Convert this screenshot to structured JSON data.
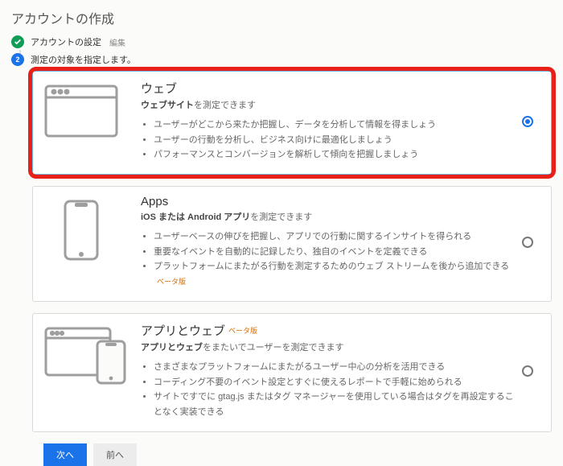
{
  "page_title": "アカウントの作成",
  "steps": {
    "done": {
      "label": "アカウントの設定",
      "edit": "編集"
    },
    "current": {
      "num": "2",
      "label": "測定の対象を指定します。"
    }
  },
  "options": {
    "web": {
      "title": "ウェブ",
      "subtitle_strong": "ウェブサイト",
      "subtitle_rest": "を測定できます",
      "bullets": [
        "ユーザーがどこから来たか把握し、データを分析して情報を得ましょう",
        "ユーザーの行動を分析し、ビジネス向けに最適化しましょう",
        "パフォーマンスとコンバージョンを解析して傾向を把握しましょう"
      ],
      "selected": true
    },
    "apps": {
      "title": "Apps",
      "subtitle_strong": "iOS または Android アプリ",
      "subtitle_rest": "を測定できます",
      "bullets": [
        "ユーザーベースの伸びを把握し、アプリでの行動に関するインサイトを得られる",
        "重要なイベントを自動的に記録したり、独自のイベントを定義できる",
        "プラットフォームにまたがる行動を測定するためのウェブ ストリームを後から追加できる"
      ],
      "beta_tag": "ベータ版",
      "selected": false
    },
    "appsweb": {
      "title": "アプリとウェブ",
      "title_beta": "ベータ版",
      "subtitle_strong": "アプリとウェブ",
      "subtitle_rest": "をまたいでユーザーを測定できます",
      "bullets": [
        "さまざまなプラットフォームにまたがるユーザー中心の分析を活用できる",
        "コーディング不要のイベント設定とすぐに使えるレポートで手軽に始められる",
        "サイトですでに gtag.js またはタグ マネージャーを使用している場合はタグを再設定することなく実装できる"
      ],
      "selected": false
    }
  },
  "buttons": {
    "next": "次へ",
    "prev": "前へ"
  }
}
